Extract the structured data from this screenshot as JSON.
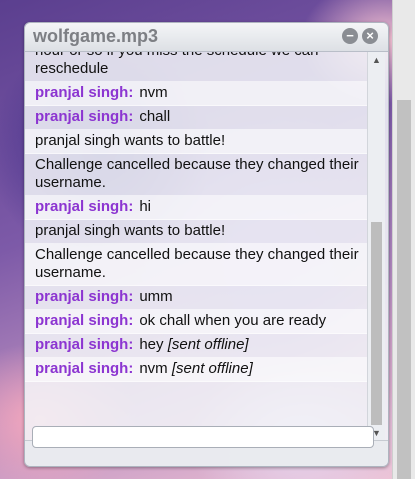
{
  "window": {
    "title": "wolfgame.mp3",
    "minimize_glyph": "−",
    "close_glyph": "×"
  },
  "messages": [
    {
      "text": "hour or so if you miss the schedule we can reschedule"
    },
    {
      "sender": "pranjal singh:",
      "text": "nvm"
    },
    {
      "sender": "pranjal singh:",
      "text": "chall"
    },
    {
      "text": "pranjal singh wants to battle!"
    },
    {
      "text": "Challenge cancelled because they changed their username."
    },
    {
      "sender": "pranjal singh:",
      "text": "hi"
    },
    {
      "text": "pranjal singh wants to battle!"
    },
    {
      "text": "Challenge cancelled because they changed their username."
    },
    {
      "sender": "pranjal singh:",
      "text": "umm"
    },
    {
      "sender": "pranjal singh:",
      "text": "ok chall when you are ready"
    },
    {
      "sender": "pranjal singh:",
      "text": "hey",
      "note": "[sent offline]"
    },
    {
      "sender": "pranjal singh:",
      "text": "nvm",
      "note": "[sent offline]"
    }
  ],
  "input": {
    "value": "",
    "placeholder": ""
  },
  "icons": {
    "scroll_up": "triangle-up-icon",
    "scroll_down": "triangle-down-icon"
  }
}
